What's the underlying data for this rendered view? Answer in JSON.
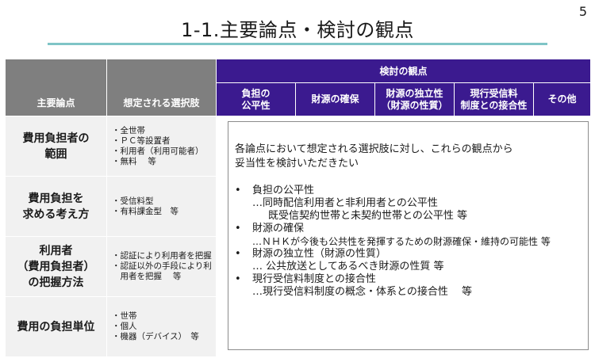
{
  "page_number": "5",
  "title": "1-1.主要論点・検討の観点",
  "table": {
    "col_main": "主要論点",
    "col_options": "想定される選択肢",
    "perspectives_header": "検討の観点",
    "perspectives": [
      {
        "line1": "負担の",
        "line2": "公平性"
      },
      {
        "line1": "財源の確保",
        "line2": ""
      },
      {
        "line1": "財源の独立性",
        "line2": "（財源の性質）"
      },
      {
        "line1": "現行受信料",
        "line2": "制度との接合性"
      },
      {
        "line1": "その他",
        "line2": ""
      }
    ],
    "rows": [
      {
        "topic": [
          "費用負担者の",
          "範囲"
        ],
        "options": [
          "・全世帯",
          "・ＰＣ等設置者",
          "・利用者（利用可能者）",
          "・無料　 等"
        ]
      },
      {
        "topic": [
          "費用負担を",
          "求める考え方"
        ],
        "options": [
          "・受信料型",
          "・有料課金型　等"
        ]
      },
      {
        "topic": [
          "利用者",
          "（費用負担者）",
          "の把握方法"
        ],
        "options": [
          "・認証により利用者を把握",
          "・認証以外の手段により利",
          "　用者を把握　 等"
        ]
      },
      {
        "topic": [
          "費用の負担単位"
        ],
        "options": [
          "・世帯",
          "・個人",
          "・機器（デバイス）　等"
        ]
      }
    ]
  },
  "overlay": {
    "intro": [
      "各論点において想定される選択肢に対し、これらの観点から",
      "妥当性を検討いただきたい"
    ],
    "items": [
      {
        "heading": "負担の公平性",
        "sub": [
          "…同時配信利用者と非利用者との公平性",
          "既受信契約世帯と未契約世帯との公平性 等"
        ]
      },
      {
        "heading": "財源の確保",
        "sub": [
          "…ＮＨＫが今後も公共性を発揮するための財源確保・維持の可能性 等"
        ]
      },
      {
        "heading": "財源の独立性（財源の性質）",
        "sub": [
          "… 公共放送としてあるべき財源の性質 等"
        ]
      },
      {
        "heading": "現行受信料制度との接合性",
        "sub": [
          "…現行受信料制度の概念・体系との接合性　 等"
        ]
      }
    ]
  }
}
